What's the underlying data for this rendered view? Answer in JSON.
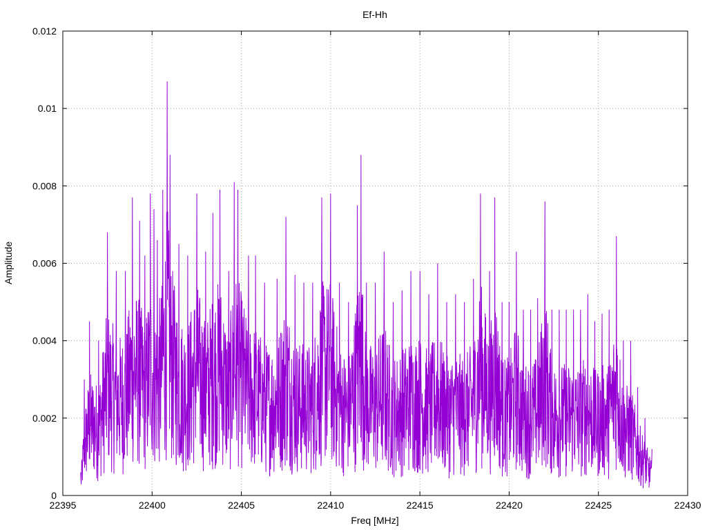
{
  "chart_data": {
    "type": "line",
    "title": "Ef-Hh",
    "xlabel": "Freq [MHz]",
    "ylabel": "Amplitude",
    "xlim": [
      22395,
      22430
    ],
    "ylim": [
      0,
      0.012
    ],
    "x_ticks": [
      "22395",
      "22400",
      "22405",
      "22410",
      "22415",
      "22420",
      "22425",
      "22430"
    ],
    "y_ticks": [
      "0",
      "0.002",
      "0.004",
      "0.006",
      "0.008",
      "0.01",
      "0.012"
    ],
    "grid": true,
    "legend": "none",
    "line_color": "#9400d3",
    "series": [
      {
        "x_start": 22396.0,
        "x_end": 22428.0,
        "peaks": [
          [
            22396.0,
            0.0006
          ],
          [
            22396.2,
            0.003
          ],
          [
            22396.5,
            0.0045
          ],
          [
            22397.0,
            0.004
          ],
          [
            22397.5,
            0.0068
          ],
          [
            22398.0,
            0.0058
          ],
          [
            22398.5,
            0.0058
          ],
          [
            22398.9,
            0.0077
          ],
          [
            22399.3,
            0.0071
          ],
          [
            22399.6,
            0.0062
          ],
          [
            22399.9,
            0.0078
          ],
          [
            22400.1,
            0.0074
          ],
          [
            22400.3,
            0.0066
          ],
          [
            22400.6,
            0.0079
          ],
          [
            22400.85,
            0.0107
          ],
          [
            22401.0,
            0.0088
          ],
          [
            22401.5,
            0.0065
          ],
          [
            22402.0,
            0.0062
          ],
          [
            22402.5,
            0.0078
          ],
          [
            22403.0,
            0.0063
          ],
          [
            22403.4,
            0.0073
          ],
          [
            22403.8,
            0.0079
          ],
          [
            22404.3,
            0.0058
          ],
          [
            22404.6,
            0.0081
          ],
          [
            22404.8,
            0.0079
          ],
          [
            22405.4,
            0.0062
          ],
          [
            22405.8,
            0.0062
          ],
          [
            22406.3,
            0.0055
          ],
          [
            22407.0,
            0.0056
          ],
          [
            22407.5,
            0.0072
          ],
          [
            22408.0,
            0.0057
          ],
          [
            22408.5,
            0.0055
          ],
          [
            22409.0,
            0.0055
          ],
          [
            22409.5,
            0.0077
          ],
          [
            22410.0,
            0.0078
          ],
          [
            22410.5,
            0.0055
          ],
          [
            22411.0,
            0.005
          ],
          [
            22411.5,
            0.0075
          ],
          [
            22411.7,
            0.0088
          ],
          [
            22412.0,
            0.0055
          ],
          [
            22412.5,
            0.0055
          ],
          [
            22413.0,
            0.0063
          ],
          [
            22413.5,
            0.005
          ],
          [
            22414.0,
            0.0053
          ],
          [
            22414.5,
            0.0058
          ],
          [
            22415.0,
            0.0058
          ],
          [
            22415.5,
            0.0052
          ],
          [
            22416.0,
            0.006
          ],
          [
            22416.5,
            0.005
          ],
          [
            22417.0,
            0.0052
          ],
          [
            22417.5,
            0.005
          ],
          [
            22418.0,
            0.0056
          ],
          [
            22418.4,
            0.0078
          ],
          [
            22418.9,
            0.0058
          ],
          [
            22419.2,
            0.0077
          ],
          [
            22419.6,
            0.005
          ],
          [
            22420.0,
            0.005
          ],
          [
            22420.4,
            0.0063
          ],
          [
            22420.8,
            0.0048
          ],
          [
            22421.2,
            0.0048
          ],
          [
            22421.6,
            0.0051
          ],
          [
            22422.0,
            0.0076
          ],
          [
            22422.4,
            0.0048
          ],
          [
            22422.8,
            0.0048
          ],
          [
            22423.2,
            0.0048
          ],
          [
            22423.6,
            0.0048
          ],
          [
            22424.0,
            0.0048
          ],
          [
            22424.4,
            0.0052
          ],
          [
            22424.8,
            0.0045
          ],
          [
            22425.2,
            0.0047
          ],
          [
            22425.6,
            0.0048
          ],
          [
            22426.0,
            0.0067
          ],
          [
            22426.4,
            0.004
          ],
          [
            22426.8,
            0.004
          ],
          [
            22427.2,
            0.0028
          ],
          [
            22427.6,
            0.002
          ],
          [
            22428.0,
            0.0012
          ]
        ]
      }
    ]
  }
}
